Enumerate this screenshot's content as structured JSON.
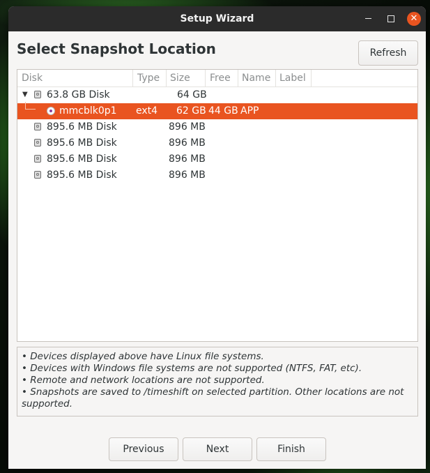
{
  "window": {
    "title": "Setup Wizard"
  },
  "heading": "Select Snapshot Location",
  "refresh_label": "Refresh",
  "columns": {
    "disk": "Disk",
    "type": "Type",
    "size": "Size",
    "free": "Free",
    "name": "Name",
    "label": "Label"
  },
  "rows": [
    {
      "disk": "63.8 GB Disk",
      "type": "",
      "size": "64 GB",
      "free": "",
      "name": "",
      "label": ""
    },
    {
      "disk": "mmcblk0p1",
      "type": "ext4",
      "size": "62 GB",
      "free": "44 GB",
      "name": "APP",
      "label": ""
    },
    {
      "disk": "895.6 MB Disk",
      "type": "",
      "size": "896 MB",
      "free": "",
      "name": "",
      "label": ""
    },
    {
      "disk": "895.6 MB Disk",
      "type": "",
      "size": "896 MB",
      "free": "",
      "name": "",
      "label": ""
    },
    {
      "disk": "895.6 MB Disk",
      "type": "",
      "size": "896 MB",
      "free": "",
      "name": "",
      "label": ""
    },
    {
      "disk": "895.6 MB Disk",
      "type": "",
      "size": "896 MB",
      "free": "",
      "name": "",
      "label": ""
    }
  ],
  "notes": [
    "• Devices displayed above have Linux file systems.",
    "• Devices with Windows file systems are not supported (NTFS, FAT, etc).",
    "• Remote and network locations are not supported.",
    "• Snapshots are saved to /timeshift on selected partition. Other locations are not supported."
  ],
  "buttons": {
    "previous": "Previous",
    "next": "Next",
    "finish": "Finish"
  },
  "colors": {
    "accent": "#e95420",
    "titlebar": "#2b2b2b",
    "partition_icon": "#8a3e9b"
  },
  "icons": {
    "expander": "triangle-down-icon",
    "disk": "disk-drive-icon",
    "partition": "partition-icon",
    "close": "close-icon",
    "maximize": "maximize-icon",
    "minimize": "minimize-icon"
  },
  "selected_row": 1
}
